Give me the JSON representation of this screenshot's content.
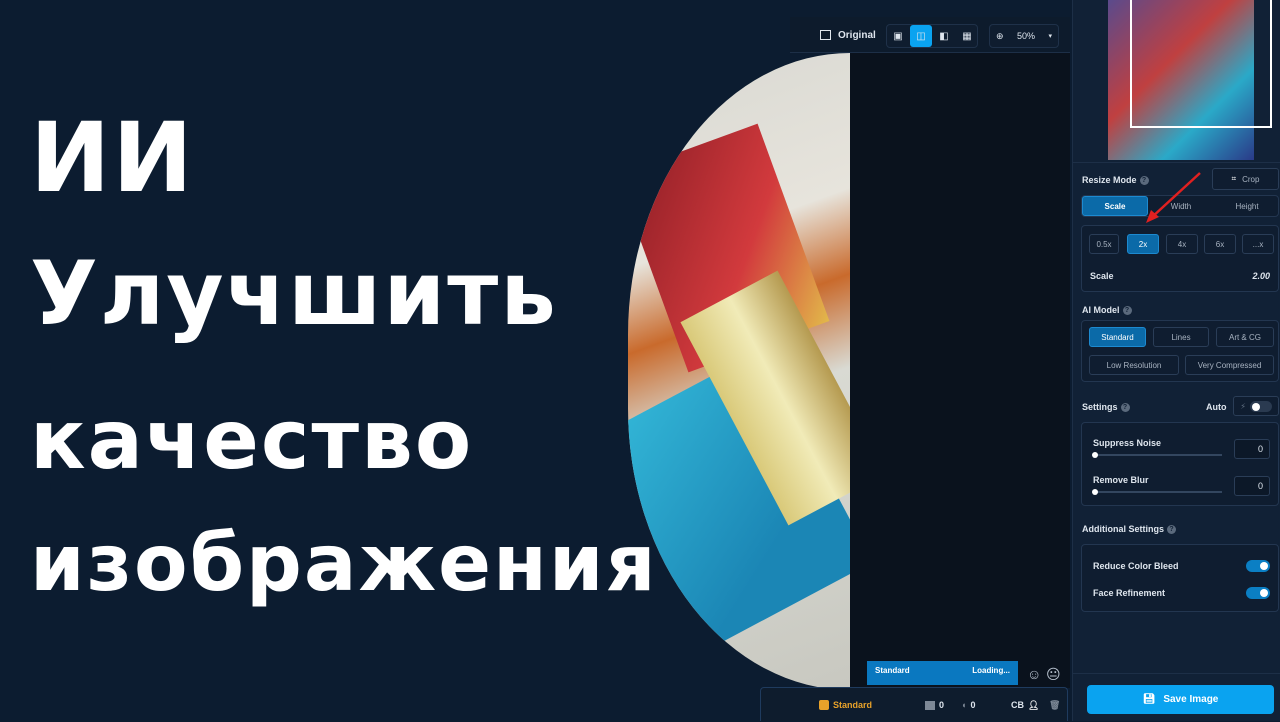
{
  "headline": [
    "ИИ",
    "Улучшить",
    "качество",
    "изображения"
  ],
  "toolbar": {
    "original_label": "Original",
    "zoom": "50%"
  },
  "status": {
    "model": "Standard",
    "state": "Loading..."
  },
  "bottom": {
    "model": "Standard",
    "images_count": "0",
    "audio_count": "0",
    "initials": "CB"
  },
  "panel": {
    "resize_mode": "Resize Mode",
    "crop": "Crop",
    "modes": [
      "Scale",
      "Width",
      "Height"
    ],
    "scales": [
      "0.5x",
      "2x",
      "4x",
      "6x",
      "...x"
    ],
    "scale_label": "Scale",
    "scale_value": "2.00",
    "ai_model": "AI Model",
    "models": [
      "Standard",
      "Lines",
      "Art & CG",
      "Low Resolution",
      "Very Compressed"
    ],
    "settings": "Settings",
    "auto": "Auto",
    "suppress_noise": "Suppress Noise",
    "suppress_noise_value": "0",
    "remove_blur": "Remove Blur",
    "remove_blur_value": "0",
    "additional": "Additional Settings",
    "reduce_color_bleed": "Reduce Color Bleed",
    "face_refinement": "Face Refinement",
    "save": "Save Image"
  },
  "colors": {
    "accent": "#0aa3f0",
    "bg": "#0c1c30",
    "warning": "#e8a22a"
  }
}
